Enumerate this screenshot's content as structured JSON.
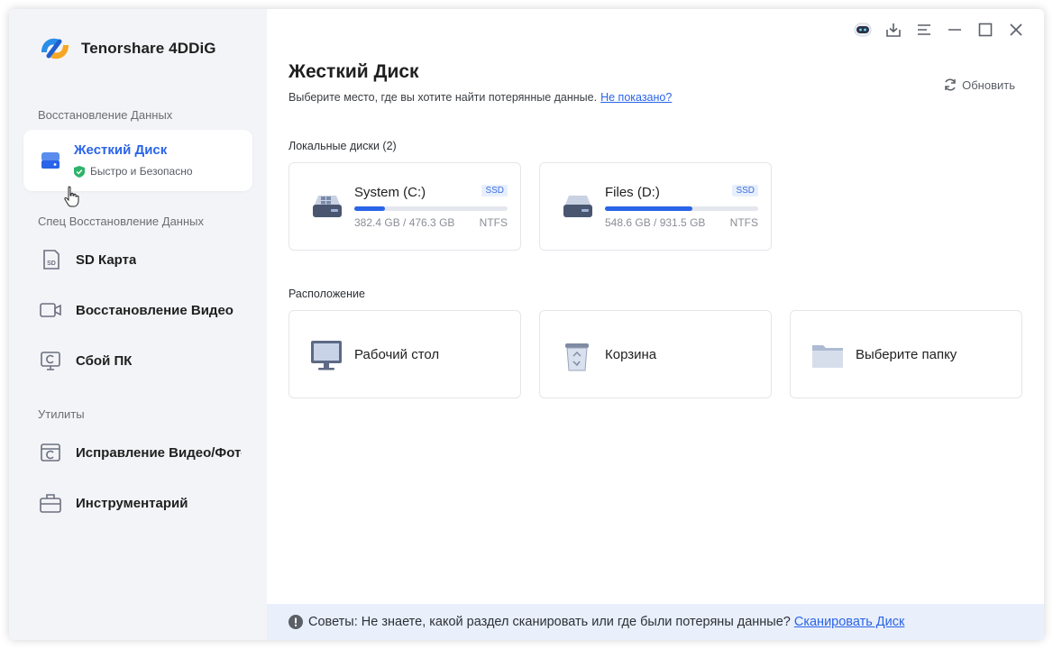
{
  "app": {
    "name": "Tenorshare 4DDiG"
  },
  "sidebar": {
    "section_recovery": "Восстановление Данных",
    "active_item": {
      "title": "Жесткий Диск",
      "subtitle": "Быстро и Безопасно"
    },
    "section_special": "Спец Восстановление Данных",
    "special_items": [
      {
        "label": "SD Карта",
        "icon": "sd-card-icon"
      },
      {
        "label": "Восстановление Видео",
        "icon": "video-camera-icon"
      },
      {
        "label": "Сбой ПК",
        "icon": "pc-crash-icon"
      }
    ],
    "section_utils": "Утилиты",
    "util_items": [
      {
        "label": "Исправление Видео/Фото",
        "icon": "repair-icon"
      },
      {
        "label": "Инструментарий",
        "icon": "toolbox-icon"
      }
    ]
  },
  "main": {
    "title": "Жесткий Диск",
    "subtitle": "Выберите место, где вы хотите найти потерянные данные.",
    "not_shown_link": "Не показано?",
    "refresh_label": "Обновить",
    "local_disks_label": "Локальные диски (2)",
    "disks": [
      {
        "name": "System (C:)",
        "badge": "SSD",
        "size": "382.4 GB / 476.3 GB",
        "fs": "NTFS",
        "used_fraction": 0.2
      },
      {
        "name": "Files (D:)",
        "badge": "SSD",
        "size": "548.6 GB / 931.5 GB",
        "fs": "NTFS",
        "used_fraction": 0.57
      }
    ],
    "location_label": "Расположение",
    "locations": [
      {
        "label": "Рабочий стол",
        "icon": "desktop-monitor-icon"
      },
      {
        "label": "Корзина",
        "icon": "recycle-bin-icon"
      },
      {
        "label": "Выберите папку",
        "icon": "folder-icon"
      }
    ]
  },
  "tips": {
    "text": "Советы: Не знаете, какой раздел сканировать или где были потеряны данные?",
    "link": "Сканировать Диск"
  },
  "colors": {
    "accent": "#2a64e8",
    "sidebar_bg": "#f3f4f7",
    "tips_bg": "#e9effb"
  }
}
